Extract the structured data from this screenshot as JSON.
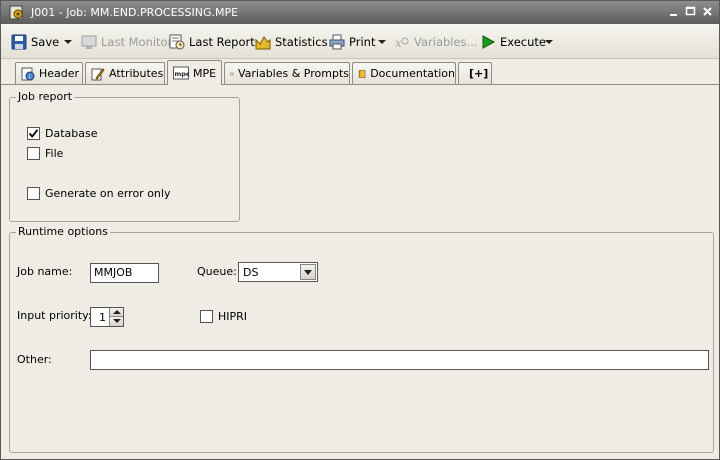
{
  "window": {
    "title": "J001 - Job: MM.END.PROCESSING.MPE"
  },
  "toolbar": {
    "save": "Save",
    "last_monitor": "Last Monitor",
    "last_report": "Last Report",
    "statistics": "Statistics",
    "print": "Print",
    "variables": "Variables...",
    "execute": "Execute"
  },
  "tabs": [
    {
      "label": "Header"
    },
    {
      "label": "Attributes"
    },
    {
      "label": "MPE"
    },
    {
      "label": "Variables & Prompts"
    },
    {
      "label": "Documentation"
    },
    {
      "label": "[+]"
    }
  ],
  "job_report": {
    "legend": "Job report",
    "database": {
      "label": "Database",
      "checked": true
    },
    "file": {
      "label": "File",
      "checked": false
    },
    "generate_on_error": {
      "label": "Generate on error only",
      "checked": false
    }
  },
  "runtime": {
    "legend": "Runtime options",
    "job_name_label": "Job name:",
    "job_name_value": "MMJOB",
    "queue_label": "Queue:",
    "queue_value": "DS",
    "input_priority_label": "Input priority:",
    "input_priority_value": "1",
    "hipri": {
      "label": "HIPRI",
      "checked": false
    },
    "other_label": "Other:",
    "other_value": ""
  },
  "colors": {
    "titlebar": "#6e6e6e",
    "execute_green": "#1a9a1a"
  }
}
